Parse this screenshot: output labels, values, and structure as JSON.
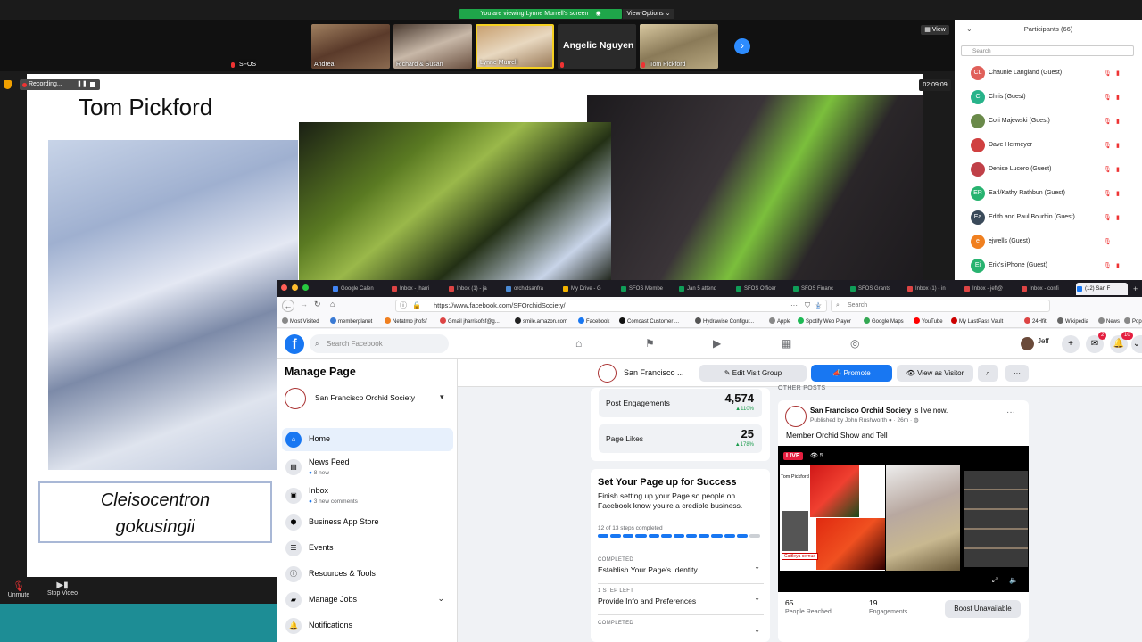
{
  "zoom": {
    "notice": "You are viewing Lynne Murrell's screen",
    "view_options": "View Options",
    "view_button": "View",
    "recording_label": "Recording...",
    "timer": "02:09:09",
    "tiles": [
      {
        "name": "SFOS",
        "color": "#4a5a3a"
      },
      {
        "name": "Andrea",
        "color": "#7a5a48"
      },
      {
        "name": "Richard & Susan",
        "color": "#6a5040"
      },
      {
        "name": "Lynne Murrell",
        "color": "#b8a080"
      },
      {
        "name": "Angelic Nguyen",
        "color": "#2a2a2a"
      },
      {
        "name": "Tom Pickford",
        "color": "#8a7a58"
      }
    ],
    "unmute": "Unmute",
    "stop_video": "Stop Video"
  },
  "slide": {
    "title": "Tom Pickford",
    "caption_line1": "Cleisocentron",
    "caption_line2": "gokusingii"
  },
  "participants": {
    "header": "Participants (66)",
    "search_placeholder": "Search",
    "list": [
      {
        "initials": "CL",
        "name": "Chaunie Langland (Guest)",
        "color": "#e0605a"
      },
      {
        "initials": "C",
        "name": "Chris (Guest)",
        "color": "#28b38a"
      },
      {
        "initials": "",
        "name": "Cori Majewski (Guest)",
        "color": "#6a8a4a"
      },
      {
        "initials": "",
        "name": "Dave Hermeyer",
        "color": "#d04040"
      },
      {
        "initials": "",
        "name": "Denise Lucero (Guest)",
        "color": "#c04048"
      },
      {
        "initials": "ER",
        "name": "Earl/Kathy Rathbun (Guest)",
        "color": "#28b370"
      },
      {
        "initials": "Ea",
        "name": "Edith and Paul Bourbin (Guest)",
        "color": "#3a4a5a"
      },
      {
        "initials": "e",
        "name": "ejwells (Guest)",
        "color": "#f08020"
      },
      {
        "initials": "Ei",
        "name": "Erik's iPhone (Guest)",
        "color": "#28b370"
      }
    ]
  },
  "browser": {
    "tabs": [
      {
        "label": "Google Calen",
        "color": "#4285f4"
      },
      {
        "label": "Inbox - jharri",
        "color": "#d44"
      },
      {
        "label": "Inbox (1) - ja",
        "color": "#d44"
      },
      {
        "label": "orchidsanfra",
        "color": "#4a8ad4"
      },
      {
        "label": "My Drive - G",
        "color": "#f4b400"
      },
      {
        "label": "SFOS Membe",
        "color": "#0f9d58"
      },
      {
        "label": "Jan 5 attend",
        "color": "#0f9d58"
      },
      {
        "label": "SFOS Officer",
        "color": "#0f9d58"
      },
      {
        "label": "SFOS Financ",
        "color": "#0f9d58"
      },
      {
        "label": "SFOS Grants",
        "color": "#0f9d58"
      },
      {
        "label": "Inbox (1) - in",
        "color": "#d44"
      },
      {
        "label": "Inbox - jeff@",
        "color": "#d44"
      },
      {
        "label": "Inbox - confi",
        "color": "#d44"
      },
      {
        "label": "(12) San F",
        "color": "#1877f2"
      }
    ],
    "url": "https://www.facebook.com/SFOrchidSociety/",
    "search_placeholder": "Search",
    "bookmarks": [
      {
        "label": "Most Visited",
        "color": "#888"
      },
      {
        "label": "memberplanet",
        "color": "#3a7ad4"
      },
      {
        "label": "Netatmo jhofsf",
        "color": "#f08020"
      },
      {
        "label": "Gmail jharrisofsf@g...",
        "color": "#d44"
      },
      {
        "label": "smile.amazon.com",
        "color": "#222"
      },
      {
        "label": "Facebook",
        "color": "#1877f2"
      },
      {
        "label": "Comcast Customer ...",
        "color": "#111"
      },
      {
        "label": "Hydrawise Configur...",
        "color": "#555"
      },
      {
        "label": "Apple",
        "color": "#888"
      },
      {
        "label": "Spotify Web Player",
        "color": "#1db954"
      },
      {
        "label": "Google Maps",
        "color": "#34a853"
      },
      {
        "label": "YouTube",
        "color": "#f00"
      },
      {
        "label": "My LastPass Vault",
        "color": "#c00"
      },
      {
        "label": "24Hfit",
        "color": "#d44"
      },
      {
        "label": "Wikipedia",
        "color": "#666"
      },
      {
        "label": "News",
        "color": "#888"
      },
      {
        "label": "Popu",
        "color": "#888"
      }
    ]
  },
  "facebook": {
    "search_placeholder": "Search Facebook",
    "user": "Jeff",
    "badge_messenger": "2",
    "badge_notifications": "10",
    "manage_page": "Manage Page",
    "page_name": "San Francisco Orchid Society",
    "page_name_short": "San Francisco ...",
    "menu": [
      {
        "label": "Home",
        "sub": ""
      },
      {
        "label": "News Feed",
        "sub": "8 new"
      },
      {
        "label": "Inbox",
        "sub": "3 new comments"
      },
      {
        "label": "Business App Store",
        "sub": ""
      },
      {
        "label": "Events",
        "sub": ""
      },
      {
        "label": "Resources & Tools",
        "sub": ""
      },
      {
        "label": "Manage Jobs",
        "sub": ""
      },
      {
        "label": "Notifications",
        "sub": ""
      }
    ],
    "edit_visit_group": "Edit Visit Group",
    "promote": "Promote",
    "view_as_visitor": "View as Visitor",
    "stats": [
      {
        "label": "Post Engagements",
        "value": "4,574",
        "change": "110%"
      },
      {
        "label": "Page Likes",
        "value": "25",
        "change": "178%"
      }
    ],
    "setup": {
      "title": "Set Your Page up for Success",
      "desc": "Finish setting up your Page so people on Facebook know you're a credible business.",
      "progress_text": "12 of 13 steps completed",
      "steps_completed": 12,
      "steps_total": 13,
      "steps": [
        {
          "status": "COMPLETED",
          "title": "Establish Your Page's Identity"
        },
        {
          "status": "1 STEP LEFT",
          "title": "Provide Info and Preferences"
        },
        {
          "status": "COMPLETED",
          "title": ""
        }
      ]
    },
    "other_posts": "OTHER POSTS",
    "post": {
      "author": "San Francisco Orchid Society",
      "author_suffix": " is live now.",
      "published_by": "Published by John Rushworth",
      "time": "26m",
      "text": "Member Orchid Show and Tell",
      "live": "LIVE",
      "viewers": "5",
      "reached_value": "65",
      "reached_label": "People Reached",
      "engagements_value": "19",
      "engagements_label": "Engagements",
      "boost": "Boost Unavailable",
      "video_title": "Tom Pickford",
      "video_caption": "Cattleya cernua"
    }
  }
}
